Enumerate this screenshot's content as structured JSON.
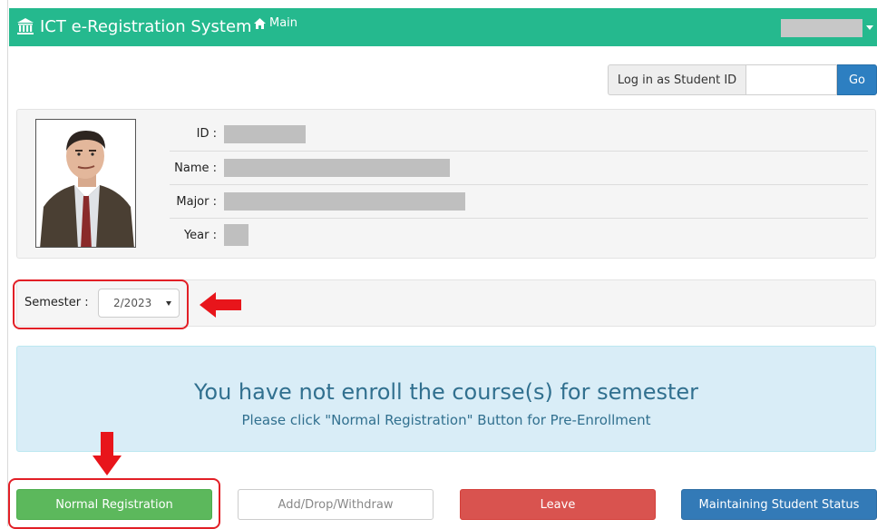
{
  "navbar": {
    "brand": "ICT e-Registration System",
    "main_link": "Main",
    "bg_color": "#25b98e"
  },
  "login_as": {
    "label": "Log in as Student ID",
    "input_value": "",
    "go_label": "Go"
  },
  "profile": {
    "rows": [
      {
        "label": "ID :"
      },
      {
        "label": "Name :"
      },
      {
        "label": "Major :"
      },
      {
        "label": "Year :"
      }
    ]
  },
  "semester": {
    "label": "Semester :",
    "selected": "2/2023"
  },
  "alert": {
    "title": "You have not enroll the course(s) for semester",
    "subtitle": "Please click \"Normal Registration\" Button for Pre-Enrollment"
  },
  "buttons": {
    "normal_registration": "Normal Registration",
    "add_drop_withdraw": "Add/Drop/Withdraw",
    "leave": "Leave",
    "maintaining_status": "Maintaining Student Status"
  },
  "icons": {
    "brand": "university-icon",
    "home": "home-icon",
    "caret": "caret-down-icon"
  }
}
